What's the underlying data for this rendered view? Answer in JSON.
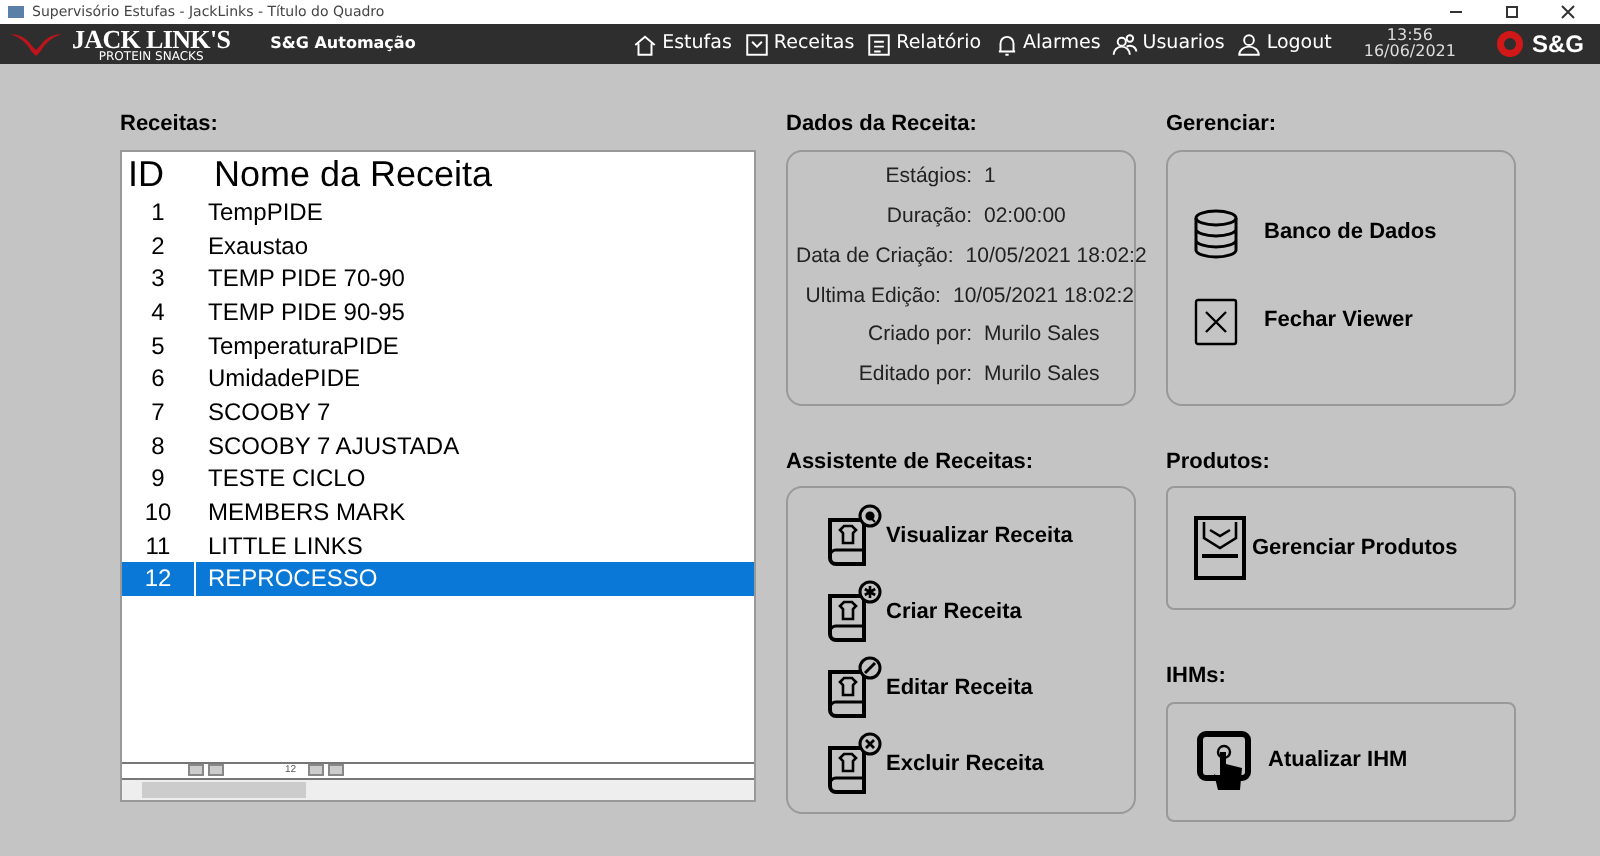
{
  "window": {
    "title": "Supervisório Estufas - JackLinks - Título do Quadro"
  },
  "header": {
    "brand": "JACK LINK'S",
    "brand_sub": "PROTEIN SNACKS",
    "company": "S&G Automação",
    "nav": [
      {
        "label": "Estufas",
        "kind": "house"
      },
      {
        "label": "Receitas",
        "kind": "book"
      },
      {
        "label": "Relatório",
        "kind": "report"
      },
      {
        "label": "Alarmes",
        "kind": "bell"
      },
      {
        "label": "Usuarios",
        "kind": "users"
      },
      {
        "label": "Logout",
        "kind": "user"
      }
    ],
    "time": "13:56",
    "date": "16/06/2021",
    "logo_text": "S&G"
  },
  "recipes": {
    "title": "Receitas:",
    "columns": [
      "ID",
      "Nome da Receita"
    ],
    "rows": [
      {
        "id": "1",
        "name": "TempPIDE",
        "selected": false
      },
      {
        "id": "2",
        "name": "Exaustao",
        "selected": false
      },
      {
        "id": "3",
        "name": "TEMP PIDE 70-90",
        "selected": false
      },
      {
        "id": "4",
        "name": "TEMP PIDE 90-95",
        "selected": false
      },
      {
        "id": "5",
        "name": "TemperaturaPIDE",
        "selected": false
      },
      {
        "id": "6",
        "name": "UmidadePIDE",
        "selected": false
      },
      {
        "id": "7",
        "name": "SCOOBY 7",
        "selected": false
      },
      {
        "id": "8",
        "name": "SCOOBY 7 AJUSTADA",
        "selected": false
      },
      {
        "id": "9",
        "name": "TESTE CICLO",
        "selected": false
      },
      {
        "id": "10",
        "name": "MEMBERS MARK",
        "selected": false
      },
      {
        "id": "11",
        "name": "LITTLE LINKS",
        "selected": false
      },
      {
        "id": "12",
        "name": "REPROCESSO",
        "selected": true
      }
    ],
    "pager": {
      "page": "12"
    }
  },
  "details": {
    "title": "Dados da Receita:",
    "fields": [
      {
        "label": "Estágios:",
        "value": "1"
      },
      {
        "label": "Duração:",
        "value": "02:00:00"
      },
      {
        "label": "Data de Criação:",
        "value": "10/05/2021 18:02:2"
      },
      {
        "label": "Ultima Edição:",
        "value": "10/05/2021 18:02:2"
      },
      {
        "label": "Criado por:",
        "value": "Murilo Sales"
      },
      {
        "label": "Editado por:",
        "value": "Murilo Sales"
      }
    ]
  },
  "manage": {
    "title": "Gerenciar:",
    "buttons": [
      {
        "label": "Banco de Dados",
        "kind": "database"
      },
      {
        "label": "Fechar Viewer",
        "kind": "close"
      }
    ]
  },
  "assistant": {
    "title": "Assistente de Receitas:",
    "buttons": [
      {
        "label": "Visualizar Receita",
        "kind": "view"
      },
      {
        "label": "Criar Receita",
        "kind": "create"
      },
      {
        "label": "Editar Receita",
        "kind": "edit"
      },
      {
        "label": "Excluir Receita",
        "kind": "delete"
      }
    ]
  },
  "products": {
    "title": "Produtos:",
    "button": "Gerenciar Produtos"
  },
  "hmis": {
    "title": "IHMs:",
    "button": "Atualizar IHM"
  }
}
